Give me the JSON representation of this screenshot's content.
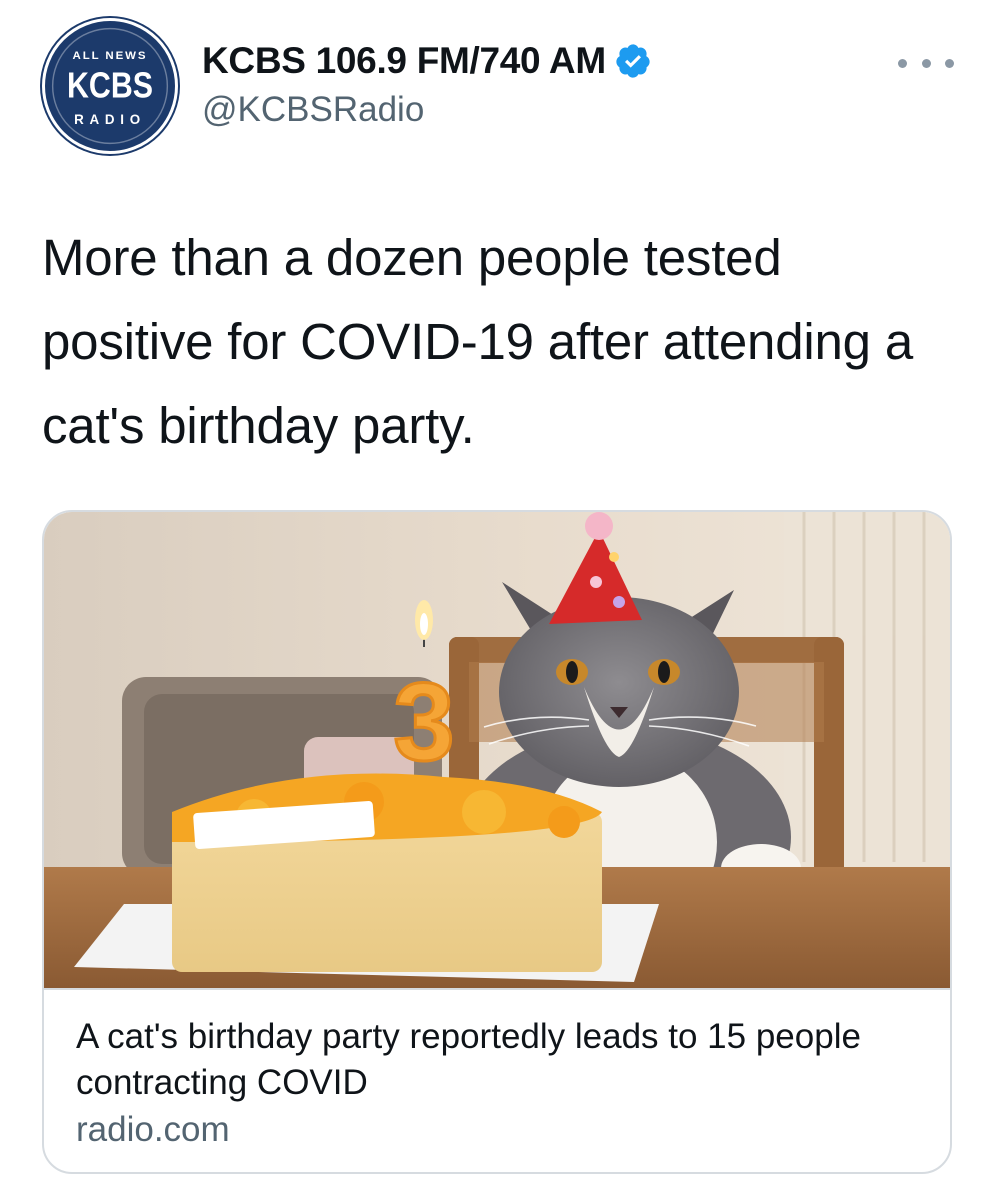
{
  "account": {
    "display_name": "KCBS 106.9 FM/740 AM",
    "handle": "@KCBSRadio",
    "verified": true,
    "avatar": {
      "top_text": "ALL NEWS",
      "main_text": "KCBS",
      "bottom_text": "RADIO",
      "color": "#1c3a6b"
    }
  },
  "tweet": {
    "text": "More than a dozen people tested positive for COVID-19 after attending a cat's birthday party."
  },
  "link_card": {
    "image_icon": "cat-birthday-photo",
    "candle_number": "3",
    "title": "A cat's birthday party reportedly leads to 15 people contracting COVID",
    "domain": "radio.com"
  },
  "icons": {
    "more": "more-dots-icon",
    "verified": "verified-badge-icon"
  },
  "colors": {
    "verified_blue": "#1d9bf0",
    "secondary_text": "#536471",
    "border": "#d6dbe0"
  }
}
